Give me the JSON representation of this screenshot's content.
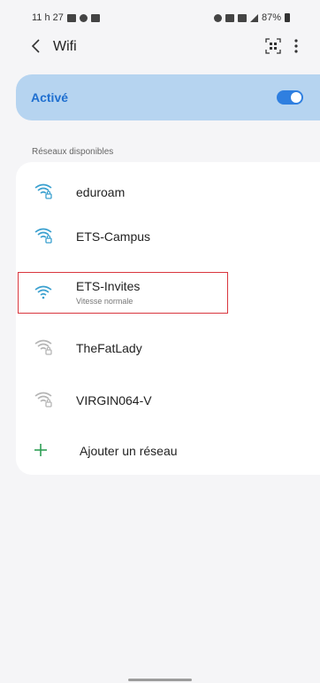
{
  "status_bar": {
    "time": "11 h 27",
    "battery": "87%"
  },
  "header": {
    "title": "Wifi"
  },
  "wifi_toggle": {
    "label": "Activé",
    "on": true
  },
  "networks_section": {
    "title": "Réseaux disponibles"
  },
  "networks": [
    {
      "name": "eduroam",
      "subtitle": "",
      "secured": true
    },
    {
      "name": "ETS-Campus",
      "subtitle": "",
      "secured": true
    },
    {
      "name": "ETS-Invites",
      "subtitle": "Vitesse normale",
      "secured": false
    },
    {
      "name": "TheFatLady",
      "subtitle": "",
      "secured": true
    },
    {
      "name": "VIRGIN064-V",
      "subtitle": "",
      "secured": true
    }
  ],
  "add_network": {
    "label": "Ajouter un réseau"
  },
  "colors": {
    "accent": "#2f7fe0",
    "active_card": "#b6d4f0",
    "wifi_strong": "#3aa0cf",
    "wifi_weak": "#b5b5b5",
    "add_plus": "#2e9e55",
    "highlight": "#d9363e"
  },
  "icons": [
    "qr-scan-icon",
    "more-options-icon",
    "back-arrow-icon",
    "wifi-lock-icon",
    "wifi-icon",
    "plus-icon"
  ]
}
